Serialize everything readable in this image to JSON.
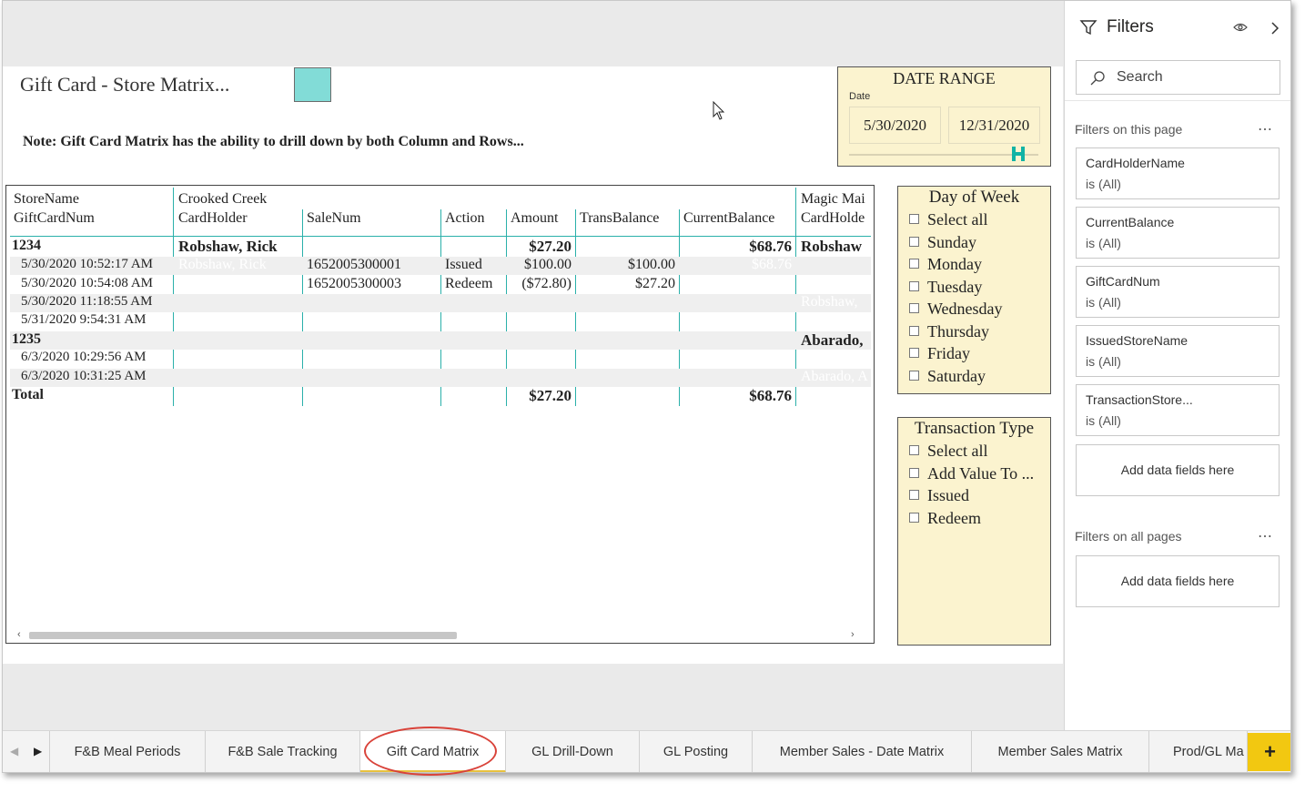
{
  "report": {
    "title": "Gift Card - Store Matrix...",
    "note": "Note: Gift Card Matrix has the ability to drill down by both Column and Rows...",
    "swatch_color": "#82dcd7"
  },
  "date_range": {
    "title": "DATE RANGE",
    "field": "Date",
    "start": "5/30/2020",
    "end": "12/31/2020"
  },
  "matrix": {
    "row_header_1": "StoreName",
    "row_header_2": "GiftCardNum",
    "col_group_1": "Crooked Creek",
    "col_group_2": "Magic Mai",
    "columns": [
      "CardHolder",
      "SaleNum",
      "Action",
      "Amount",
      "TransBalance",
      "CurrentBalance"
    ],
    "col_group_2_sub": "CardHolde",
    "rows": [
      {
        "label": "1234",
        "bold": true,
        "cardholder": "Robshaw, Rick",
        "salenum": "",
        "action": "",
        "amount": "$27.20",
        "transbalance": "",
        "currentbalance": "$68.76",
        "mm": "Robshaw"
      },
      {
        "label": "5/30/2020 10:52:17 AM",
        "bold": false,
        "cardholder": "Robshaw, Rick",
        "salenum": "1652005300001",
        "action": "Issued",
        "amount": "$100.00",
        "transbalance": "$100.00",
        "currentbalance": "$68.76",
        "mm": ""
      },
      {
        "label": "5/30/2020 10:54:08 AM",
        "bold": false,
        "cardholder": "",
        "salenum": "1652005300003",
        "action": "Redeem",
        "amount": "($72.80)",
        "transbalance": "$27.20",
        "currentbalance": "",
        "mm": ""
      },
      {
        "label": "5/30/2020 11:18:55 AM",
        "bold": false,
        "cardholder": "",
        "salenum": "",
        "action": "",
        "amount": "",
        "transbalance": "",
        "currentbalance": "",
        "mm": "Robshaw,"
      },
      {
        "label": "5/31/2020 9:54:31 AM",
        "bold": false,
        "cardholder": "",
        "salenum": "",
        "action": "",
        "amount": "",
        "transbalance": "",
        "currentbalance": "",
        "mm": ""
      },
      {
        "label": "1235",
        "bold": true,
        "cardholder": "",
        "salenum": "",
        "action": "",
        "amount": "",
        "transbalance": "",
        "currentbalance": "",
        "mm": "Abarado,"
      },
      {
        "label": "6/3/2020 10:29:56 AM",
        "bold": false,
        "cardholder": "",
        "salenum": "",
        "action": "",
        "amount": "",
        "transbalance": "",
        "currentbalance": "",
        "mm": ""
      },
      {
        "label": "6/3/2020 10:31:25 AM",
        "bold": false,
        "cardholder": "",
        "salenum": "",
        "action": "",
        "amount": "",
        "transbalance": "",
        "currentbalance": "",
        "mm": "Abarado, A"
      }
    ],
    "total": {
      "label": "Total",
      "amount": "$27.20",
      "currentbalance": "$68.76"
    }
  },
  "day_of_week": {
    "title": "Day of Week",
    "items": [
      "Select all",
      "Sunday",
      "Monday",
      "Tuesday",
      "Wednesday",
      "Thursday",
      "Friday",
      "Saturday"
    ]
  },
  "transaction_type": {
    "title": "Transaction Type",
    "items": [
      "Select all",
      "Add Value To ...",
      "Issued",
      "Redeem"
    ]
  },
  "filters": {
    "title": "Filters",
    "search_placeholder": "Search",
    "on_this_page": "Filters on this page",
    "on_all_pages": "Filters on all pages",
    "cards": [
      {
        "name": "CardHolderName",
        "value": "is (All)"
      },
      {
        "name": "CurrentBalance",
        "value": "is (All)"
      },
      {
        "name": "GiftCardNum",
        "value": "is (All)"
      },
      {
        "name": "IssuedStoreName",
        "value": "is (All)"
      },
      {
        "name": "TransactionStore...",
        "value": "is (All)"
      }
    ],
    "add_fields": "Add data fields here"
  },
  "tabs": [
    "F&B Meal Periods",
    "F&B Sale Tracking",
    "Gift Card Matrix",
    "GL Drill-Down",
    "GL Posting",
    "Member Sales - Date Matrix",
    "Member Sales Matrix",
    "Prod/GL Ma"
  ],
  "active_tab": "Gift Card Matrix",
  "add_tab_label": "+"
}
